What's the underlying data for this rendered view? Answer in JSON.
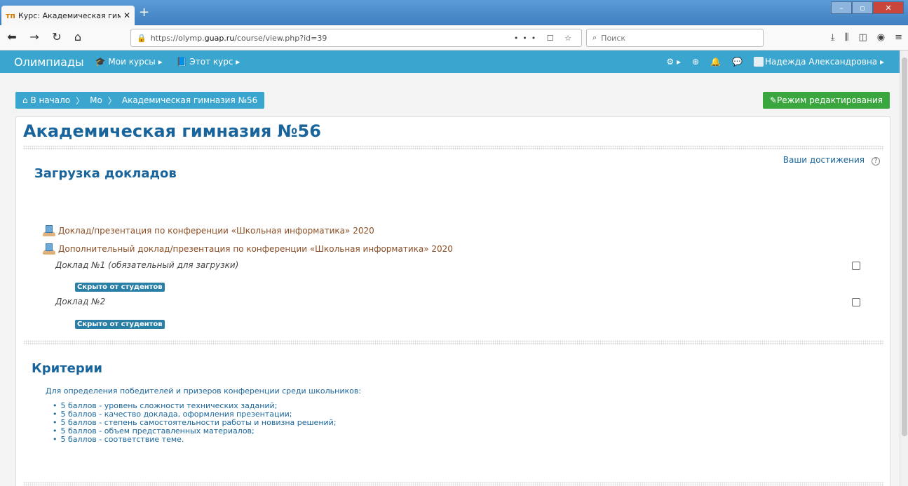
{
  "browser": {
    "tab_title": "Курс: Академическая гимназ",
    "tab_favicon": "тп",
    "url_prefix": "https://olymp.",
    "url_host": "guap.ru",
    "url_path": "/course/view.php?id=39",
    "search_placeholder": "Поиск",
    "url_actions": "••• ☐ ☆"
  },
  "moodle_bar": {
    "brand": "Олимпиады",
    "my_courses": "Мои курсы ▸",
    "this_course": "Этот курс ▸",
    "user_name": "Надежда Александровна ▸"
  },
  "breadcrumb": {
    "home": "В начало",
    "level2": "Мо",
    "level3": "Академическая гимназия №56"
  },
  "edit_button": "Режим редактирования",
  "course_title": "Академическая гимназия №56",
  "section1": {
    "title": "Загрузка докладов",
    "achievements_link": "Ваши достижения",
    "activities": [
      "Доклад/презентация по конференции «Школьная информатика» 2020",
      "Дополнительный доклад/презентация по конференции «Школьная информатика» 2020"
    ],
    "labels": [
      "Доклад №1 (обязательный для загрузки)",
      "Доклад №2"
    ],
    "hidden_badge": "Скрыто от студентов"
  },
  "section2": {
    "title": "Критерии",
    "intro": "Для определения победителей и призеров конференции среди школьников:",
    "items": [
      "5 баллов - уровень сложности технических заданий;",
      "5 баллов - качество доклада, оформления презентации;",
      "5 баллов - степень самостоятельности работы и новизна решений;",
      "5 баллов - объем представленных материалов;",
      "5 баллов - соответствие теме."
    ]
  },
  "colors": {
    "moodle_bar": "#3aa6d0",
    "title_text": "#19659b",
    "edit_button": "#3aa63e",
    "badge": "#2a7fa6",
    "activity_link": "#8a4d23"
  }
}
